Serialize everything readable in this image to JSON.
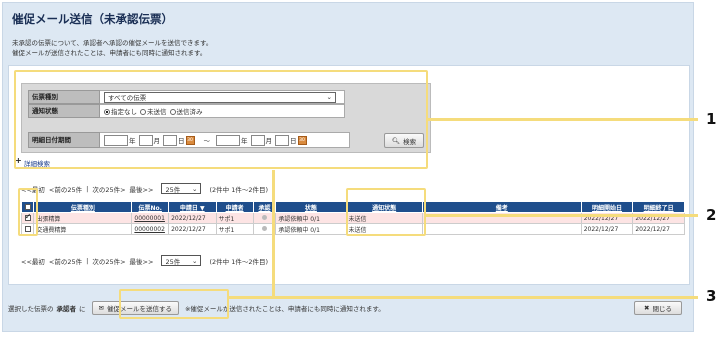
{
  "page": {
    "title": "催促メール送信（未承認伝票）",
    "description": [
      "未承認の伝票について、承認者へ承認の催促メールを送信できます。",
      "催促メールが送信されたことは、申請者にも同時に通知されます。"
    ]
  },
  "form": {
    "slip_type_label": "伝票種別",
    "slip_type_value": "すべての伝票",
    "notify_status_label": "通知状態",
    "radio_options": [
      "指定なし",
      "未送信",
      "送信済み"
    ],
    "detail_date_label": "明細日付期間",
    "date_year": "年",
    "date_month": "月",
    "date_day": "日",
    "date_range_sep": "〜",
    "search_button": "検索",
    "detail_search_link": "詳細検索"
  },
  "pager": {
    "first": "<<最初",
    "prev": "<前の25件",
    "sep": "|",
    "next": "次の25件>",
    "last": "最後>>",
    "per_page": "25件",
    "count": "(2件中 1件〜2件目)"
  },
  "table": {
    "columns": [
      "伝票種別",
      "伝票No.",
      "申請日 ▼",
      "申請者",
      "承認",
      "状態",
      "通知状態",
      "備考",
      "明細開始日",
      "明細終了日"
    ],
    "rows": [
      {
        "selected": true,
        "slip_type": "出張精算",
        "slip_no": "00000001",
        "date": "2022/12/27",
        "applicant": "サポ1",
        "state": "承認依頼中 0/1",
        "notify": "未送信",
        "note": "",
        "start": "2022/12/27",
        "end": "2022/12/27"
      },
      {
        "selected": false,
        "slip_type": "交通費精算",
        "slip_no": "00000002",
        "date": "2022/12/27",
        "applicant": "サポ1",
        "state": "承認依頼中 0/1",
        "notify": "未送信",
        "note": "",
        "start": "2022/12/27",
        "end": "2022/12/27"
      }
    ]
  },
  "footer": {
    "prefix": "選択した伝票の",
    "approver": "承認者",
    "particle": "に",
    "send_button": "催促メールを送信する",
    "note": "※催促メールが送信されたことは、申請者にも同時に通知されます。",
    "close_button": "閉じる"
  },
  "callouts": [
    "1",
    "2",
    "3"
  ],
  "colors": {
    "header_blue": "#1f4e8c",
    "highlight_yellow": "#f5dc7c",
    "panel_bg": "#dde8f3",
    "selected_row": "#fde4e4"
  }
}
